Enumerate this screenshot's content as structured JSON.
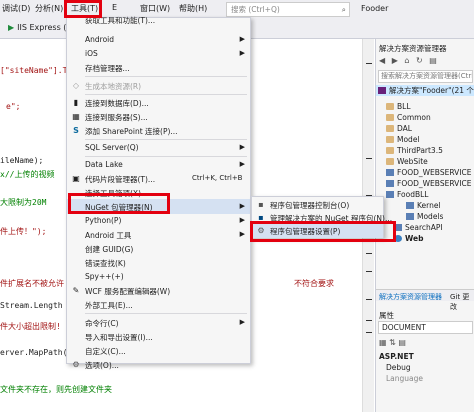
{
  "menubar": {
    "items": [
      "调试(D)",
      "分析(N)",
      "工具(T)",
      "E",
      "窗口(W)",
      "帮助(H)"
    ],
    "search_placeholder": "搜索 (Ctrl+Q)",
    "solution_name": "Fooder"
  },
  "toolbar": {
    "run_target": "IIS Express (3("
  },
  "editor": {
    "lines": [
      {
        "text": "[\"siteName\"].To",
        "style": "red"
      },
      {
        "text": "e\";",
        "style": "red"
      },
      {
        "text": "ileName);",
        "style": ""
      },
      {
        "text": "x//上传的视频",
        "style": "green"
      },
      {
        "text": "大限制为20M",
        "style": "green"
      },
      {
        "text": "件上传！\");",
        "style": "red"
      },
      {
        "text": "件扩展名不被允许",
        "style": "red"
      },
      {
        "text": "不符合要求",
        "style": "red"
      },
      {
        "text": "Stream.Length >",
        "style": ""
      },
      {
        "text": "件大小超出限制!",
        "style": "red"
      },
      {
        "text": "erver.MapPath(\"/",
        "style": ""
      },
      {
        "text": "文件夹不存在，则先创建文件夹",
        "style": "green"
      }
    ]
  },
  "tools_menu": {
    "items": [
      {
        "icon": "",
        "label": "获取工具和功能(T)...",
        "shortcut": "",
        "arrow": false
      },
      {
        "icon": "",
        "label": "Android",
        "shortcut": "",
        "arrow": true
      },
      {
        "icon": "",
        "label": "iOS",
        "shortcut": "",
        "arrow": true
      },
      {
        "icon": "",
        "label": "存档管理器...",
        "shortcut": "",
        "arrow": false
      },
      {
        "icon": "◇",
        "label": "生成本地资源(R)",
        "shortcut": "",
        "arrow": false,
        "disabled": true
      },
      {
        "icon": "▮",
        "label": "连接到数据库(D)...",
        "shortcut": "",
        "arrow": false
      },
      {
        "icon": "▦",
        "label": "连接到服务器(S)...",
        "shortcut": "",
        "arrow": false
      },
      {
        "icon": "S",
        "label": "添加 SharePoint 连接(P)...",
        "shortcut": "",
        "arrow": false
      },
      {
        "icon": "",
        "label": "SQL Server(Q)",
        "shortcut": "",
        "arrow": true
      },
      {
        "icon": "",
        "label": "Data Lake",
        "shortcut": "",
        "arrow": true
      },
      {
        "icon": "▣",
        "label": "代码片段管理器(T)...",
        "shortcut": "Ctrl+K, Ctrl+B",
        "arrow": false
      },
      {
        "icon": "",
        "label": "选择工具箱项(X)...",
        "shortcut": "",
        "arrow": false
      },
      {
        "icon": "",
        "label": "NuGet 包管理器(N)",
        "shortcut": "",
        "arrow": true,
        "highlight": true
      },
      {
        "icon": "",
        "label": "Python(P)",
        "shortcut": "",
        "arrow": true
      },
      {
        "icon": "",
        "label": "Android 工具",
        "shortcut": "",
        "arrow": true
      },
      {
        "icon": "",
        "label": "创建 GUID(G)",
        "shortcut": "",
        "arrow": false
      },
      {
        "icon": "",
        "label": "错误查找(K)",
        "shortcut": "",
        "arrow": false
      },
      {
        "icon": "",
        "label": "Spy++(+)",
        "shortcut": "",
        "arrow": false
      },
      {
        "icon": "✎",
        "label": "WCF 服务配置编辑器(W)",
        "shortcut": "",
        "arrow": false
      },
      {
        "icon": "",
        "label": "外部工具(E)...",
        "shortcut": "",
        "arrow": false
      },
      {
        "icon": "",
        "label": "命令行(C)",
        "shortcut": "",
        "arrow": true
      },
      {
        "icon": "",
        "label": "导入和导出设置(I)...",
        "shortcut": "",
        "arrow": false
      },
      {
        "icon": "",
        "label": "自定义(C)...",
        "shortcut": "",
        "arrow": false
      },
      {
        "icon": "⚙",
        "label": "选项(O)...",
        "shortcut": "",
        "arrow": false
      }
    ]
  },
  "nuget_submenu": {
    "items": [
      {
        "icon": "▪",
        "label": "程序包管理器控制台(O)",
        "highlight": false
      },
      {
        "icon": "▪",
        "label": "管理解决方案的 NuGet 程序包(N)...",
        "highlight": false
      },
      {
        "icon": "⚙",
        "label": "程序包管理器设置(P)",
        "highlight": true
      }
    ]
  },
  "solution_explorer": {
    "title": "解决方案资源管理器",
    "search_placeholder": "搜索解决方案资源管理器(Ctrl+;)",
    "tree": [
      {
        "label": "解决方案\"Fooder\"(21 个项目)",
        "icon": "sol",
        "indent": 2,
        "selected": true
      },
      {
        "label": "BLL",
        "icon": "folder",
        "indent": 10
      },
      {
        "label": "Common",
        "icon": "folder",
        "indent": 10
      },
      {
        "label": "DAL",
        "icon": "folder",
        "indent": 10
      },
      {
        "label": "Model",
        "icon": "folder",
        "indent": 10
      },
      {
        "label": "ThirdPart3.5",
        "icon": "folder",
        "indent": 10
      },
      {
        "label": "WebSite",
        "icon": "folder",
        "indent": 10
      },
      {
        "label": "FOOD_WEBSERVICE",
        "icon": "proj",
        "indent": 10
      },
      {
        "label": "FOOD_WEBSERVICE",
        "icon": "proj",
        "indent": 10
      },
      {
        "label": "FoodBLL",
        "icon": "proj",
        "indent": 10
      },
      {
        "label": "Kernel",
        "icon": "proj",
        "indent": 30
      },
      {
        "label": "Models",
        "icon": "proj",
        "indent": 30
      },
      {
        "label": "SearchAPI",
        "icon": "proj",
        "indent": 18
      },
      {
        "label": "Web",
        "icon": "globe",
        "indent": 18
      }
    ],
    "tabs": [
      "解决方案资源管理器",
      "Git 更改"
    ]
  },
  "properties": {
    "title": "属性",
    "document": "DOCUMENT",
    "category": "ASP.NET",
    "rows": [
      "Debug",
      "Language"
    ]
  }
}
